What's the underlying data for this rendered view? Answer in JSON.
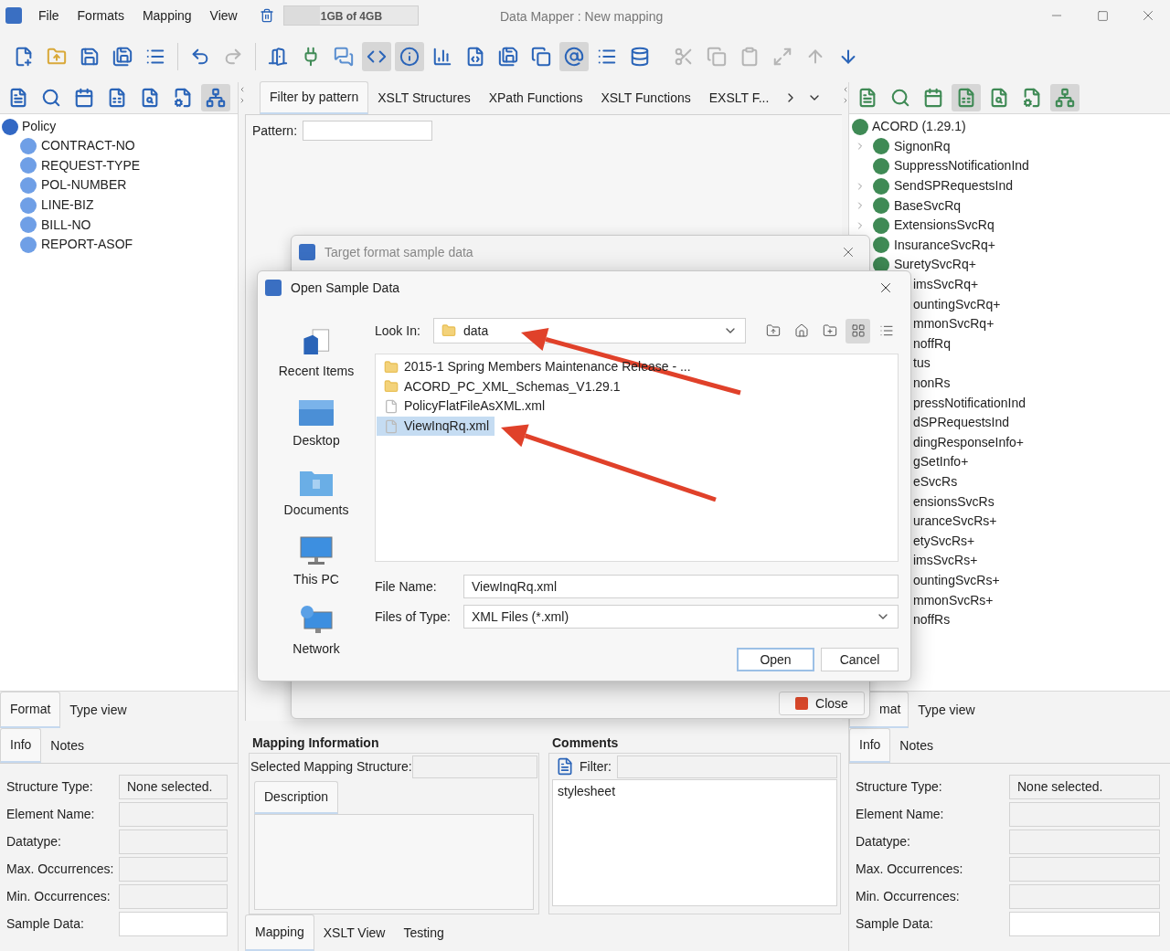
{
  "titlebar": {
    "menus": [
      "File",
      "Formats",
      "Mapping",
      "View"
    ],
    "memory": {
      "text": "1GB of 4GB",
      "level": 0.27
    },
    "title": "Data Mapper : New mapping"
  },
  "toolbar": [
    {
      "pressed": false,
      "disabled": false
    },
    {
      "pressed": false,
      "disabled": false
    },
    {
      "pressed": false,
      "disabled": false
    },
    {
      "pressed": false,
      "disabled": false
    },
    {
      "pressed": false,
      "disabled": false
    },
    {
      "pressed": false,
      "disabled": false
    },
    {
      "pressed": false,
      "disabled": true
    },
    {
      "pressed": false,
      "disabled": false
    },
    {
      "pressed": false,
      "disabled": false
    },
    {
      "pressed": false,
      "disabled": false
    },
    {
      "pressed": true,
      "disabled": false
    },
    {
      "pressed": true,
      "disabled": false
    },
    {
      "pressed": false,
      "disabled": false
    },
    {
      "pressed": false,
      "disabled": false
    },
    {
      "pressed": false,
      "disabled": false
    },
    {
      "pressed": false,
      "disabled": false
    },
    {
      "pressed": true,
      "disabled": false
    },
    {
      "pressed": false,
      "disabled": false
    },
    {
      "pressed": false,
      "disabled": false
    },
    {
      "pressed": false,
      "disabled": true
    },
    {
      "pressed": false,
      "disabled": true
    },
    {
      "pressed": false,
      "disabled": true
    },
    {
      "pressed": false,
      "disabled": true
    },
    {
      "pressed": false,
      "disabled": true
    },
    {
      "pressed": false,
      "disabled": false
    }
  ],
  "left_panel": {
    "toolbar": [
      {
        "pressed": false
      },
      {
        "pressed": false
      },
      {
        "pressed": false
      },
      {
        "pressed": false
      },
      {
        "pressed": false
      },
      {
        "pressed": false
      },
      {
        "pressed": true
      }
    ],
    "tree": {
      "label": "Policy",
      "children": [
        {
          "label": "CONTRACT-NO"
        },
        {
          "label": "REQUEST-TYPE"
        },
        {
          "label": "POL-NUMBER"
        },
        {
          "label": "LINE-BIZ"
        },
        {
          "label": "BILL-NO"
        },
        {
          "label": "REPORT-ASOF"
        }
      ]
    },
    "view_tabs": [
      {
        "label": "Format",
        "selected": true
      },
      {
        "label": "Type view",
        "selected": false
      }
    ],
    "info_tabs": [
      {
        "label": "Info",
        "selected": true
      },
      {
        "label": "Notes",
        "selected": false
      }
    ],
    "fields": [
      {
        "label": "Structure Type:",
        "value": "None selected."
      },
      {
        "label": "Element Name:"
      },
      {
        "label": "Datatype:"
      },
      {
        "label": "Max. Occurrences:"
      },
      {
        "label": "Min. Occurrences:"
      },
      {
        "label": "Sample Data:",
        "editable": true
      }
    ]
  },
  "center": {
    "tabs": [
      {
        "label": "Filter by pattern",
        "selected": true
      },
      {
        "label": "XSLT Structures",
        "selected": false
      },
      {
        "label": "XPath Functions",
        "selected": false
      },
      {
        "label": "XSLT Functions",
        "selected": false
      },
      {
        "label": "EXSLT F...",
        "selected": false
      }
    ],
    "pattern_label": "Pattern:",
    "mapping_info": {
      "title": "Mapping Information",
      "selected_label": "Selected Mapping Structure:",
      "tabs": [
        {
          "label": "Description",
          "selected": true
        }
      ]
    },
    "comments": {
      "title": "Comments",
      "filter_label": "Filter:",
      "items": [
        "stylesheet"
      ]
    },
    "bottom_tabs": [
      {
        "label": "Mapping",
        "selected": true
      },
      {
        "label": "XSLT View",
        "selected": false
      },
      {
        "label": "Testing",
        "selected": false
      }
    ]
  },
  "right_panel": {
    "toolbar": [
      {
        "pressed": false
      },
      {
        "pressed": false
      },
      {
        "pressed": false
      },
      {
        "pressed": true
      },
      {
        "pressed": false
      },
      {
        "pressed": false
      },
      {
        "pressed": true
      }
    ],
    "tree": {
      "label": "ACORD (1.29.1)",
      "children": [
        {
          "label": "SignonRq",
          "kind": "full",
          "expandable": true
        },
        {
          "label": "SuppressNotificationInd",
          "kind": "full",
          "expandable": false
        },
        {
          "label": "SendSPRequestsInd",
          "kind": "full",
          "expandable": true
        },
        {
          "label": "BaseSvcRq",
          "kind": "full",
          "expandable": true
        },
        {
          "label": "ExtensionsSvcRq",
          "kind": "full",
          "expandable": true
        },
        {
          "label": "InsuranceSvcRq+",
          "kind": "full",
          "expandable": false
        },
        {
          "label": "SuretySvcRq+",
          "kind": "full",
          "expandable": false
        },
        {
          "label": "imsSvcRq+",
          "kind": "partial"
        },
        {
          "label": "ountingSvcRq+",
          "kind": "partial"
        },
        {
          "label": "mmonSvcRq+",
          "kind": "partial"
        },
        {
          "label": "noffRq",
          "kind": "partial"
        },
        {
          "label": "tus",
          "kind": "partial"
        },
        {
          "label": "nonRs",
          "kind": "partial"
        },
        {
          "label": "pressNotificationInd",
          "kind": "partial"
        },
        {
          "label": "dSPRequestsInd",
          "kind": "partial"
        },
        {
          "label": "dingResponseInfo+",
          "kind": "partial"
        },
        {
          "label": "gSetInfo+",
          "kind": "partial"
        },
        {
          "label": "eSvcRs",
          "kind": "partial"
        },
        {
          "label": "ensionsSvcRs",
          "kind": "partial"
        },
        {
          "label": "uranceSvcRs+",
          "kind": "partial"
        },
        {
          "label": "etySvcRs+",
          "kind": "partial"
        },
        {
          "label": "imsSvcRs+",
          "kind": "partial"
        },
        {
          "label": "ountingSvcRs+",
          "kind": "partial"
        },
        {
          "label": "mmonSvcRs+",
          "kind": "partial"
        },
        {
          "label": "noffRs",
          "kind": "partial"
        }
      ]
    },
    "view_tabs": [
      {
        "label": "mat",
        "selected": true
      },
      {
        "label": "Type view",
        "selected": false
      }
    ],
    "info_tabs": [
      {
        "label": "Info",
        "selected": true
      },
      {
        "label": "Notes",
        "selected": false
      }
    ],
    "fields": [
      {
        "label": "Structure Type:",
        "value": "None selected."
      },
      {
        "label": "Element Name:"
      },
      {
        "label": "Datatype:"
      },
      {
        "label": "Max. Occurrences:"
      },
      {
        "label": "Min. Occurrences:"
      },
      {
        "label": "Sample Data:",
        "editable": true
      }
    ]
  },
  "target_dialog": {
    "title": "Target format sample data",
    "close_button": "Close"
  },
  "open_dialog": {
    "title": "Open Sample Data",
    "places": [
      "Recent Items",
      "Desktop",
      "Documents",
      "This PC",
      "Network"
    ],
    "look_in_label": "Look In:",
    "look_in": "data",
    "nav_buttons": [
      {
        "pressed": false
      },
      {
        "pressed": false
      },
      {
        "pressed": false
      },
      {
        "pressed": true
      },
      {
        "pressed": false
      }
    ],
    "files": [
      {
        "name": "2015-1 Spring Members Maintenance Release - ...",
        "kind": "folder",
        "selected": false
      },
      {
        "name": "ACORD_PC_XML_Schemas_V1.29.1",
        "kind": "folder",
        "selected": false
      },
      {
        "name": "PolicyFlatFileAsXML.xml",
        "kind": "file",
        "selected": false
      },
      {
        "name": "ViewInqRq.xml",
        "kind": "file",
        "selected": true
      }
    ],
    "file_name_label": "File Name:",
    "file_name": "ViewInqRq.xml",
    "file_type_label": "Files of Type:",
    "file_type": "XML Files (*.xml)",
    "buttons": [
      {
        "label": "Open",
        "kind": "primary"
      },
      {
        "label": "Cancel",
        "kind": "normal"
      }
    ]
  }
}
